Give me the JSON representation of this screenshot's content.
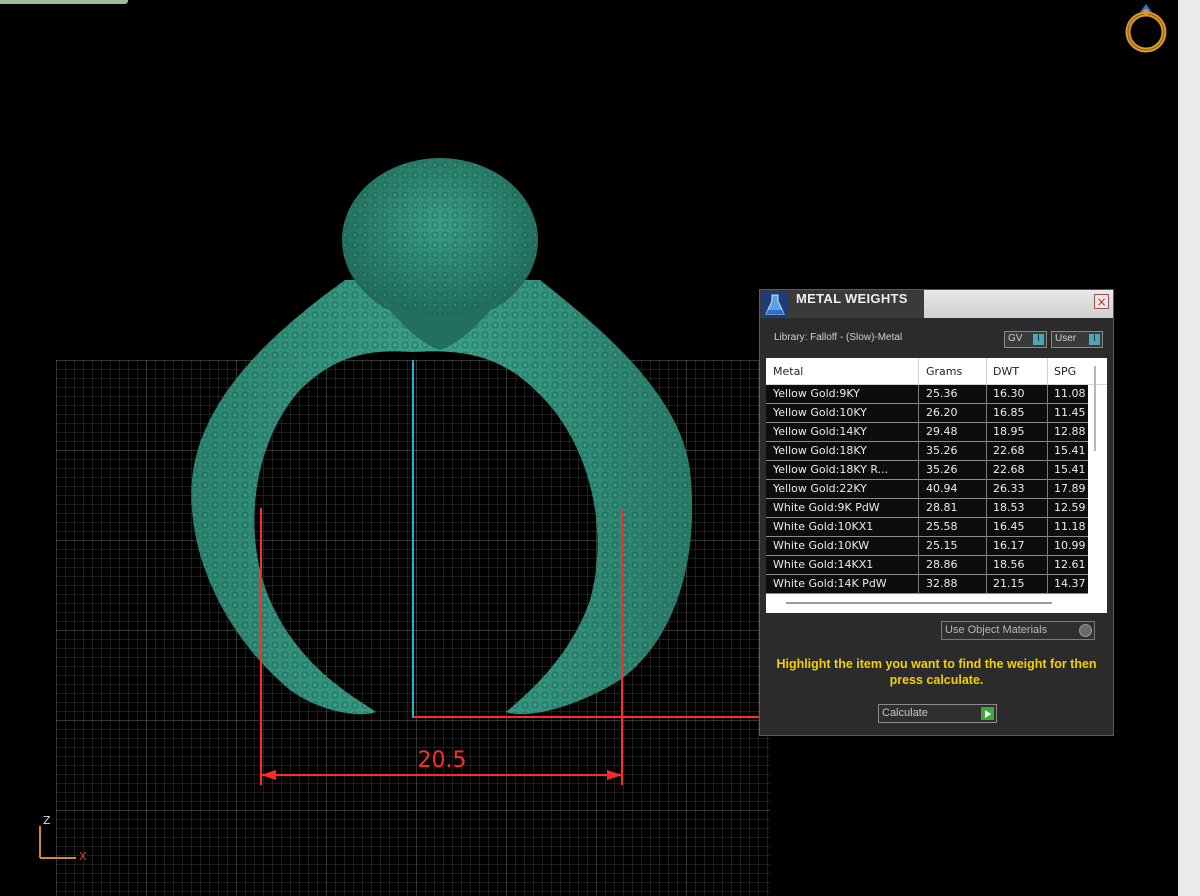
{
  "viewport": {
    "dimension_label": "20.5",
    "axis_z": "Z",
    "axis_x": "X"
  },
  "panel": {
    "title": "METAL WEIGHTS",
    "close_label": "×",
    "library_label": "Library: Falloff - (Slow)-Metal",
    "gv_label": "GV",
    "user_label": "User",
    "indicator_glyph": "I",
    "columns": {
      "metal": "Metal",
      "grams": "Grams",
      "dwt": "DWT",
      "spg": "SPG"
    },
    "rows": [
      {
        "metal": "Yellow Gold:9KY",
        "grams": "25.36",
        "dwt": "16.30",
        "spg": "11.08"
      },
      {
        "metal": "Yellow Gold:10KY",
        "grams": "26.20",
        "dwt": "16.85",
        "spg": "11.45"
      },
      {
        "metal": "Yellow Gold:14KY",
        "grams": "29.48",
        "dwt": "18.95",
        "spg": "12.88"
      },
      {
        "metal": "Yellow Gold:18KY",
        "grams": "35.26",
        "dwt": "22.68",
        "spg": "15.41"
      },
      {
        "metal": "Yellow Gold:18KY R...",
        "grams": "35.26",
        "dwt": "22.68",
        "spg": "15.41"
      },
      {
        "metal": "Yellow Gold:22KY",
        "grams": "40.94",
        "dwt": "26.33",
        "spg": "17.89"
      },
      {
        "metal": "White Gold:9K PdW",
        "grams": "28.81",
        "dwt": "18.53",
        "spg": "12.59"
      },
      {
        "metal": "White Gold:10KX1",
        "grams": "25.58",
        "dwt": "16.45",
        "spg": "11.18"
      },
      {
        "metal": "White Gold:10KW",
        "grams": "25.15",
        "dwt": "16.17",
        "spg": "10.99"
      },
      {
        "metal": "White Gold:14KX1",
        "grams": "28.86",
        "dwt": "18.56",
        "spg": "12.61"
      },
      {
        "metal": "White Gold:14K PdW",
        "grams": "32.88",
        "dwt": "21.15",
        "spg": "14.37"
      }
    ],
    "use_object_materials_label": "Use Object Materials",
    "instructions": "Highlight the item you want to find the weight for then press calculate.",
    "calculate_label": "Calculate"
  },
  "colors": {
    "ring_material": "#2f8c77",
    "dimension_red": "#ff2b2b",
    "center_line": "#1fb4c8",
    "instruction_text": "#f5d000"
  }
}
